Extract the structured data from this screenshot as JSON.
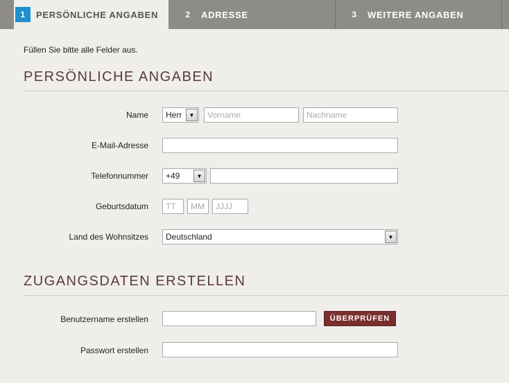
{
  "tabs": [
    {
      "num": "1",
      "label": "Persönliche Angaben",
      "active": true
    },
    {
      "num": "2",
      "label": "Adresse",
      "active": false
    },
    {
      "num": "3",
      "label": "Weitere Angaben",
      "active": false
    }
  ],
  "intro": "Füllen Sie bitte alle Felder aus.",
  "section_personal": {
    "title": "Persönliche Angaben",
    "name_label": "Name",
    "salutation_value": "Herr",
    "firstname_placeholder": "Vorname",
    "lastname_placeholder": "Nachname",
    "email_label": "E-Mail-Adresse",
    "phone_label": "Telefonnummer",
    "phone_prefix_value": "+49",
    "birth_label": "Geburtsdatum",
    "birth_day_placeholder": "TT",
    "birth_month_placeholder": "MM",
    "birth_year_placeholder": "JJJJ",
    "country_label": "Land des Wohnsitzes",
    "country_value": "Deutschland"
  },
  "section_access": {
    "title": "Zugangsdaten erstellen",
    "username_label": "Benutzername erstellen",
    "check_button": "Überprüfen",
    "password_label": "Passwort erstellen"
  },
  "icons": {
    "dropdown_arrow": "▼"
  },
  "colors": {
    "accent_blue": "#1e8fcf",
    "button_maroon": "#7a2f2f",
    "heading": "#5a3a3a"
  }
}
